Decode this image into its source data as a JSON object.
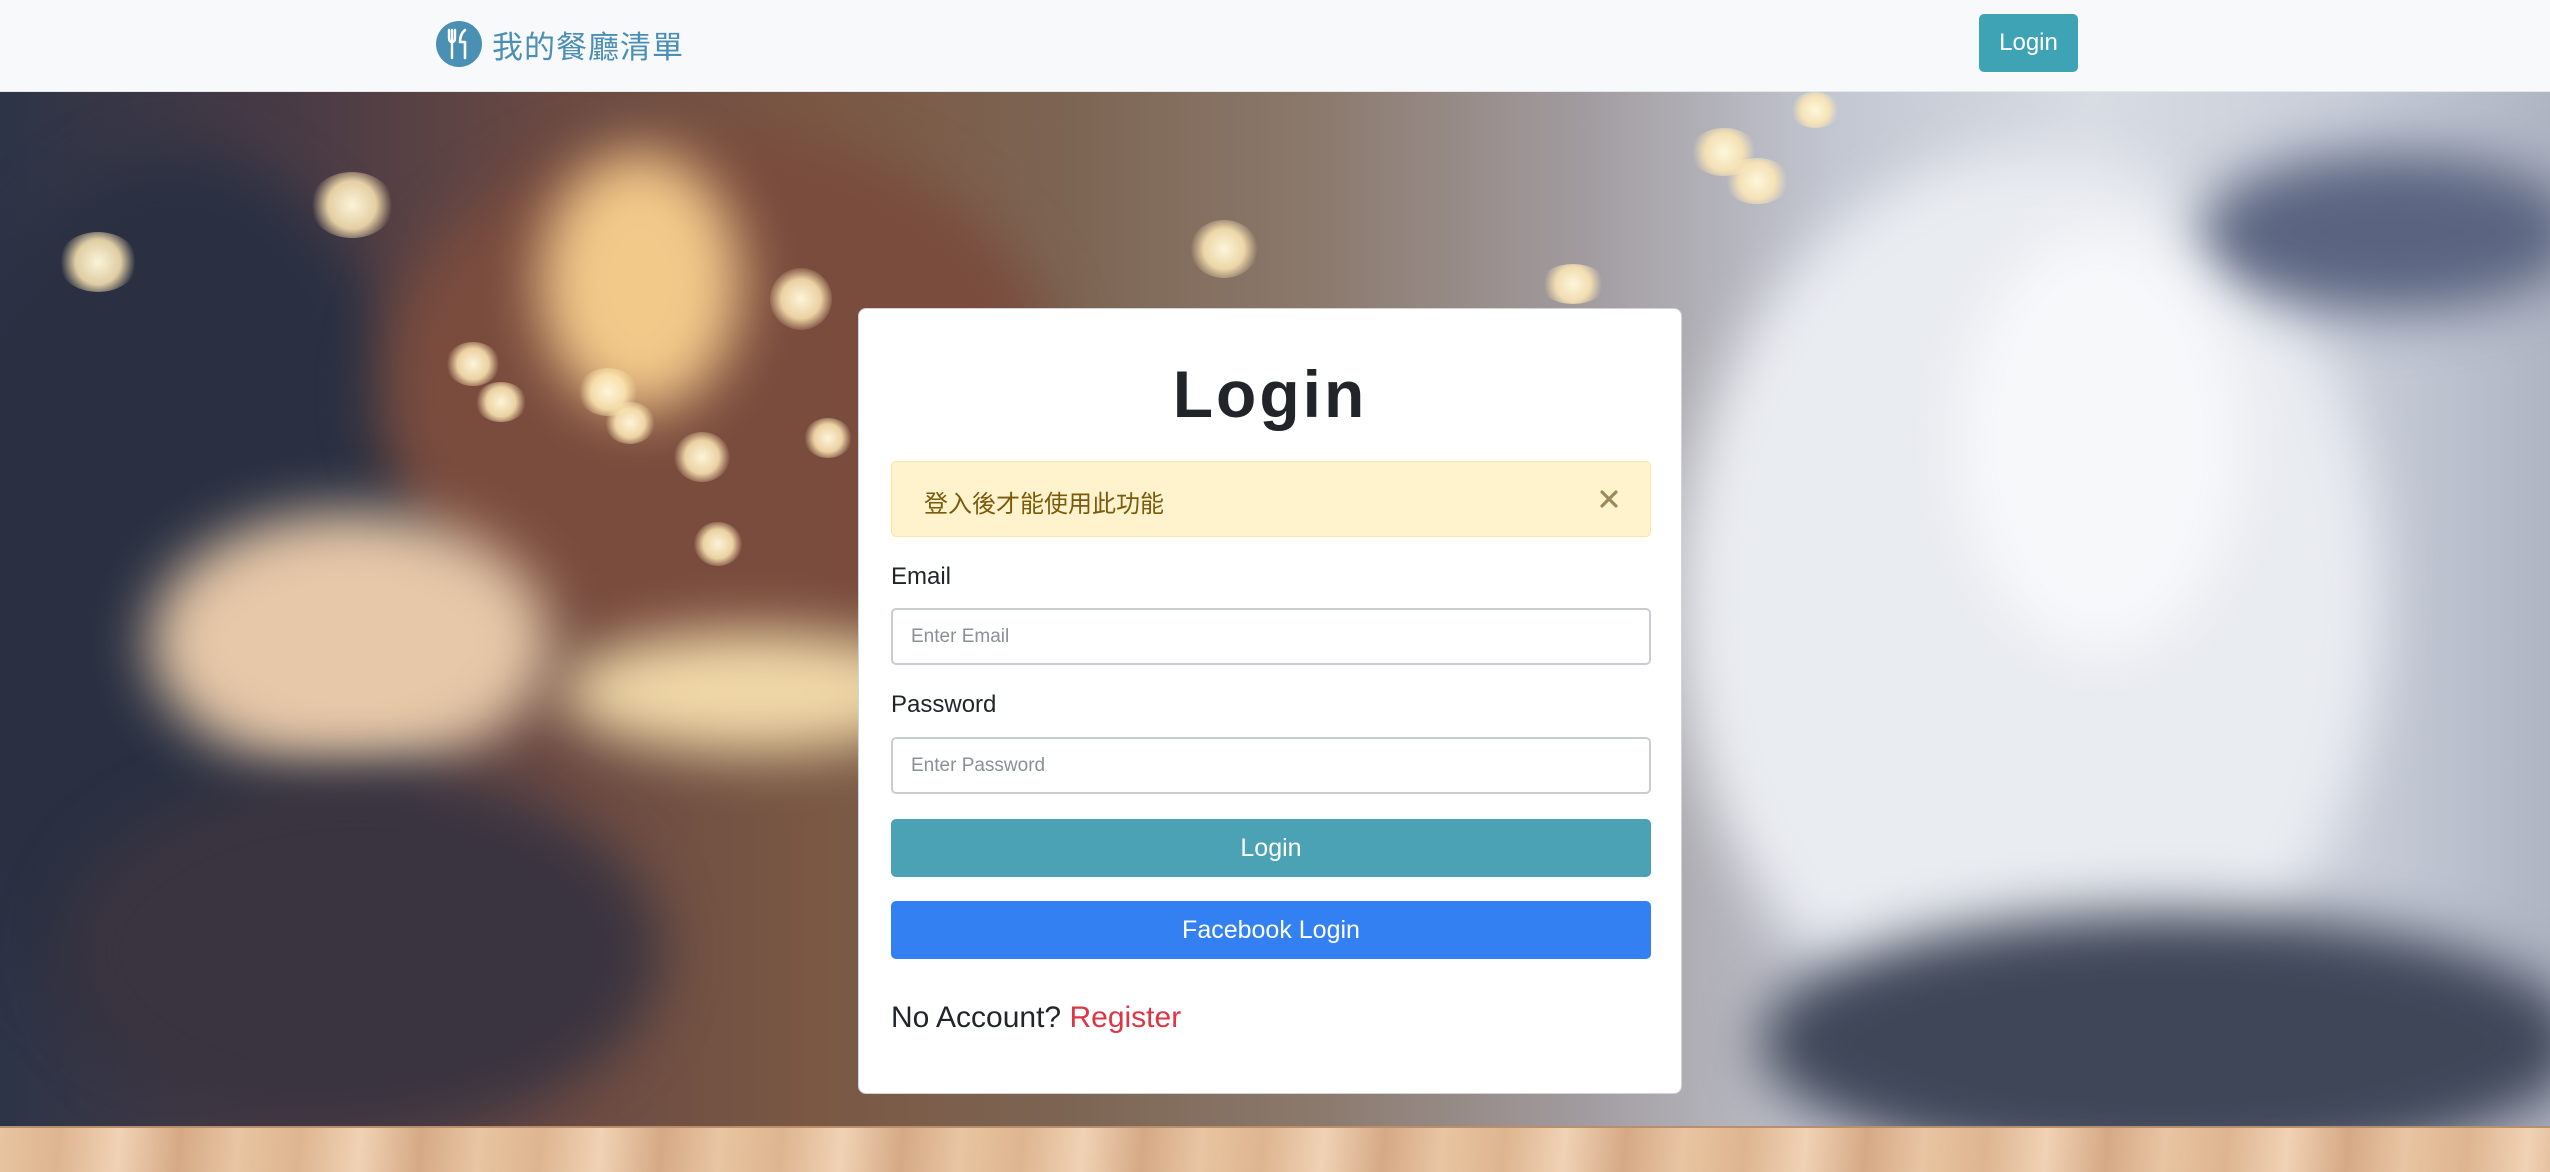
{
  "navbar": {
    "brand_text": "我的餐廳清單",
    "brand_icon": "utensils-icon",
    "login_label": "Login"
  },
  "login_card": {
    "title": "Login",
    "alert": {
      "message": "登入後才能使用此功能",
      "close_icon": "close-icon"
    },
    "email": {
      "label": "Email",
      "placeholder": "Enter Email",
      "value": ""
    },
    "password": {
      "label": "Password",
      "placeholder": "Enter Password",
      "value": ""
    },
    "login_button": "Login",
    "facebook_button": "Facebook Login",
    "register_prompt": "No Account?",
    "register_link": "Register"
  },
  "colors": {
    "brand": "#4a8fb4",
    "nav_button": "#3ea3b4",
    "login_button": "#4aa2b4",
    "facebook_button": "#3280f2",
    "alert_bg": "#fff3cd",
    "alert_text": "#7a5a0c",
    "register_link": "#dc3545"
  }
}
